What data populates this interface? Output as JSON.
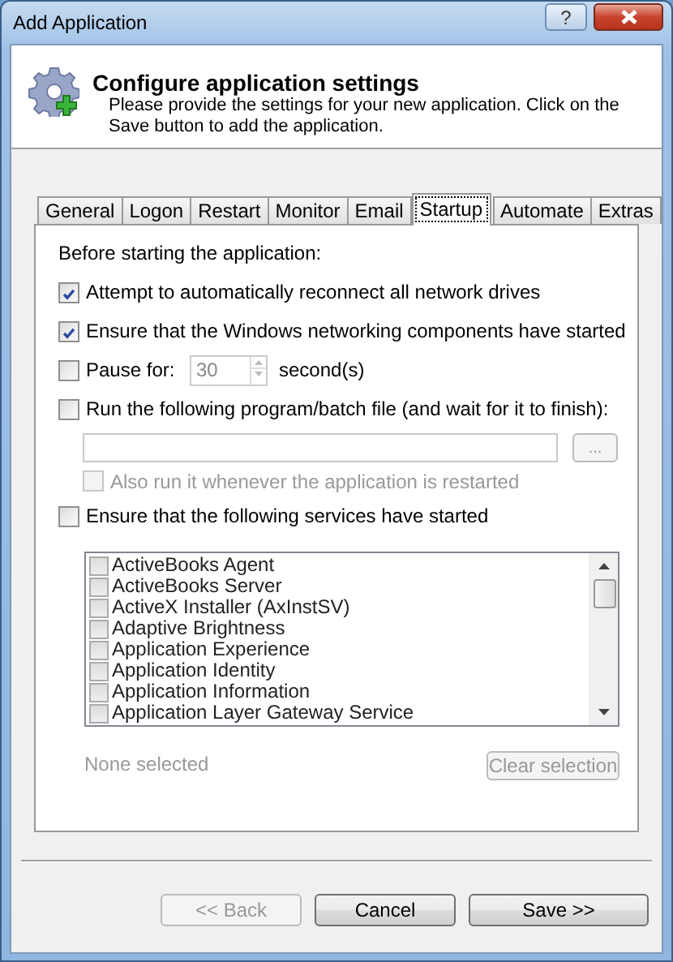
{
  "window": {
    "title": "Add Application",
    "help_button": "?"
  },
  "header": {
    "title": "Configure application settings",
    "description": "Please provide the settings for your new application. Click on the Save button to add the application."
  },
  "tabs": [
    {
      "label": "General",
      "selected": false
    },
    {
      "label": "Logon",
      "selected": false
    },
    {
      "label": "Restart",
      "selected": false
    },
    {
      "label": "Monitor",
      "selected": false
    },
    {
      "label": "Email",
      "selected": false
    },
    {
      "label": "Startup",
      "selected": true
    },
    {
      "label": "Automate",
      "selected": false
    },
    {
      "label": "Extras",
      "selected": false
    }
  ],
  "section_label": "Before starting the application:",
  "options": [
    {
      "kind": "checkbox",
      "label": "Attempt to automatically reconnect all network drives",
      "checked": true
    },
    {
      "kind": "checkbox",
      "label": "Ensure that the Windows networking components have started",
      "checked": true
    },
    {
      "kind": "pause",
      "label": "Pause for:",
      "checked": false,
      "value": "30",
      "unit": "second(s)"
    },
    {
      "kind": "checkbox",
      "label": "Run the following program/batch file (and wait for it to finish):",
      "checked": false
    },
    {
      "kind": "file",
      "browse_label": "...",
      "disabled": true
    },
    {
      "kind": "subcheckbox",
      "label": "Also run it whenever the application is restarted",
      "checked": false,
      "disabled": true
    },
    {
      "kind": "checkbox",
      "label": "Ensure that the following services have started",
      "checked": false
    }
  ],
  "services": [
    {
      "name": "ActiveBooks Agent",
      "checked": false
    },
    {
      "name": "ActiveBooks Server",
      "checked": false
    },
    {
      "name": "ActiveX Installer (AxInstSV)",
      "checked": false
    },
    {
      "name": "Adaptive Brightness",
      "checked": false
    },
    {
      "name": "Application Experience",
      "checked": false
    },
    {
      "name": "Application Identity",
      "checked": false
    },
    {
      "name": "Application Information",
      "checked": false
    },
    {
      "name": "Application Layer Gateway Service",
      "checked": false
    }
  ],
  "selection_status": "None selected",
  "clear_button": {
    "label": "Clear selection",
    "disabled": true
  },
  "buttons": [
    {
      "label": "<< Back",
      "disabled": true
    },
    {
      "label": "Cancel",
      "disabled": false
    },
    {
      "label": "Save >>",
      "disabled": false
    }
  ]
}
